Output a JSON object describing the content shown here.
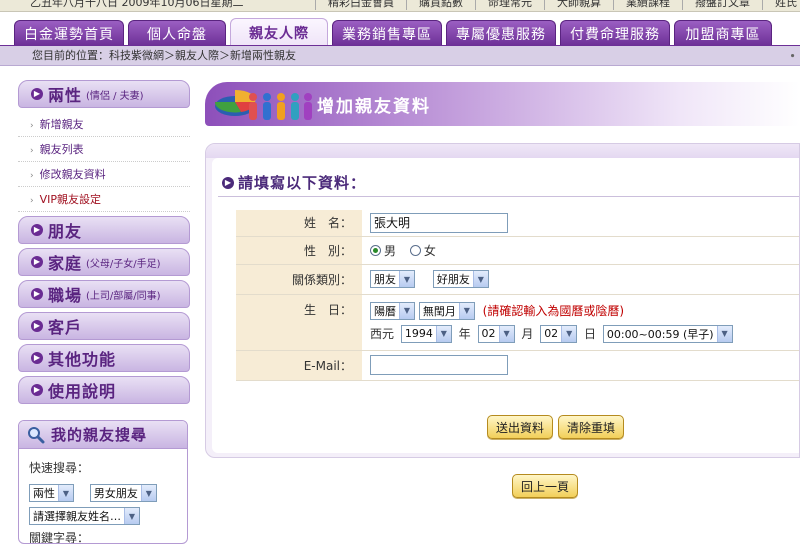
{
  "topbar": {
    "date_text": "乙丑年八月十八日 2009年10月06日星期二",
    "links": [
      "精彩白金會員",
      "購買點數",
      "命理常元",
      "大師親算",
      "業績課程",
      "撥盤訂文章",
      "姓氏"
    ]
  },
  "nav": {
    "tabs": [
      {
        "label": "白金運勢首頁",
        "active": false
      },
      {
        "label": "個人命盤",
        "active": false
      },
      {
        "label": "親友人際",
        "active": true
      },
      {
        "label": "業務銷售專區",
        "active": false
      },
      {
        "label": "專屬優惠服務",
        "active": false
      },
      {
        "label": "付費命理服務",
        "active": false
      },
      {
        "label": "加盟商專區",
        "active": false
      }
    ]
  },
  "breadcrumb": {
    "text": "您目前的位置：科技紫微網＞親友人際＞新增兩性親友",
    "right_mark": "∙"
  },
  "sidebar": {
    "sections": [
      {
        "title": "兩性",
        "subtitle": "(情侶 / 夫妻)",
        "items": [
          "新增親友",
          "親友列表",
          "修改親友資料",
          "VIP親友設定"
        ]
      },
      {
        "title": "朋友",
        "subtitle": "",
        "items": []
      },
      {
        "title": "家庭",
        "subtitle": "(父母/子女/手足)",
        "items": []
      },
      {
        "title": "職場",
        "subtitle": "(上司/部屬/同事)",
        "items": []
      },
      {
        "title": "客戶",
        "subtitle": "",
        "items": []
      },
      {
        "title": "其他功能",
        "subtitle": "",
        "items": []
      },
      {
        "title": "使用說明",
        "subtitle": "",
        "items": []
      }
    ],
    "search": {
      "title": "我的親友搜尋",
      "quick_label": "快速搜尋：",
      "type_select": "兩性",
      "relation_select": "男女朋友",
      "name_select": "請選擇親友姓名…",
      "keyword_label": "關鍵字尋："
    }
  },
  "banner": {
    "title": "增加親友資料"
  },
  "form": {
    "section_title": "請填寫以下資料：",
    "name_label": "姓　名：",
    "name_value": "張大明",
    "gender_label": "性　別：",
    "gender_options": [
      "男",
      "女"
    ],
    "gender_selected": "男",
    "relation_label": "關係類別：",
    "relation_primary": "朋友",
    "relation_secondary": "好朋友",
    "birthday_label": "生　日：",
    "calendar_select": "陽曆",
    "leap_select": "無閏月",
    "calendar_note": "(請確認輸入為國曆或陰曆)",
    "era_label": "西元",
    "year": "1994",
    "year_unit": "年",
    "month": "02",
    "month_unit": "月",
    "day": "02",
    "day_unit": "日",
    "hour": "00:00~00:59 (早子)",
    "email_label": "E-Mail：",
    "email_value": "",
    "submit_label": "送出資料",
    "reset_label": "清除重填",
    "back_label": "回上一頁"
  },
  "colors": {
    "accent_purple": "#6c2f96",
    "label_bg": "#f7ecd6",
    "button_gold": "#f2cf5a",
    "note_red": "#c00000"
  }
}
